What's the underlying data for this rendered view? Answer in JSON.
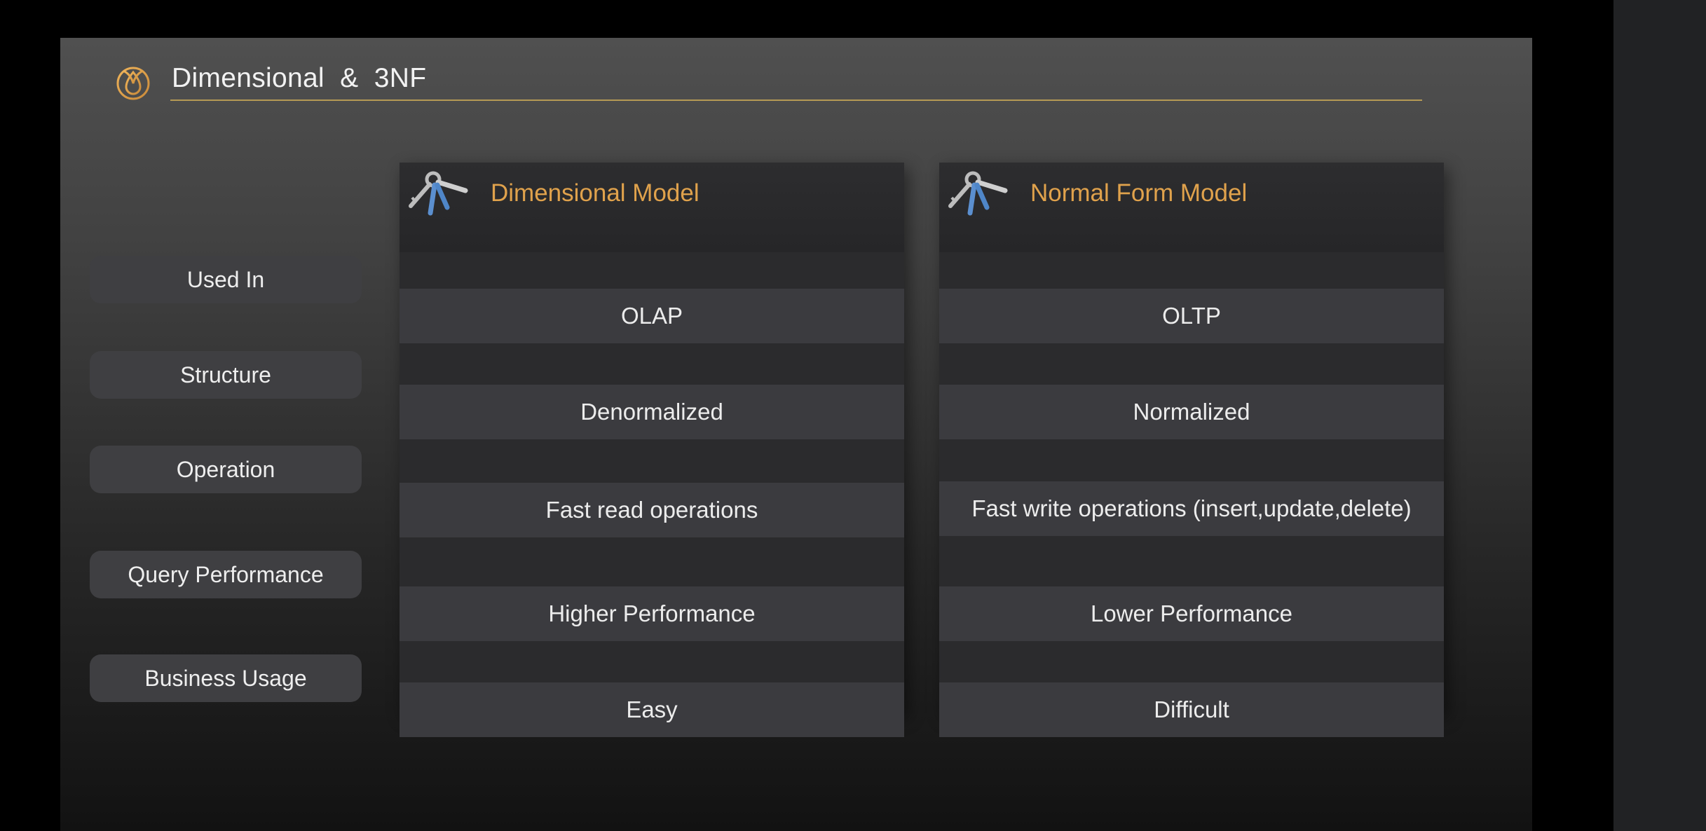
{
  "slide": {
    "title": "Dimensional  &  3NF",
    "accent_color": "#e0a24c",
    "rule_color": "#b59a55",
    "logo_icon": "drop-logo-icon"
  },
  "rows": {
    "labels": [
      "Used In",
      "Structure",
      "Operation",
      "Query Performance",
      "Business Usage"
    ]
  },
  "columns": [
    {
      "title": "Dimensional Model",
      "icon": "keys-icon",
      "cells": [
        "OLAP",
        "Denormalized",
        "Fast read operations",
        "Higher Performance",
        "Easy"
      ]
    },
    {
      "title": "Normal Form Model",
      "icon": "keys-icon",
      "cells": [
        "OLTP",
        "Normalized",
        "Fast write operations (insert,update,delete)",
        "Lower Performance",
        "Difficult"
      ]
    }
  ]
}
